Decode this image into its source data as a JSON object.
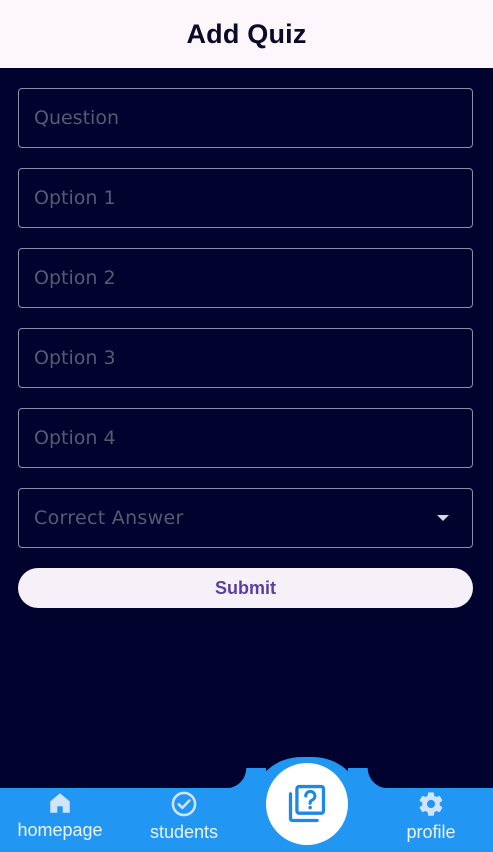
{
  "appbar": {
    "title": "Add Quiz"
  },
  "form": {
    "question_placeholder": "Question",
    "option1_placeholder": "Option 1",
    "option2_placeholder": "Option 2",
    "option3_placeholder": "Option 3",
    "option4_placeholder": "Option 4",
    "correct_answer_placeholder": "Correct Answer",
    "submit_label": "Submit"
  },
  "nav": {
    "items": [
      {
        "label": "homepage",
        "icon": "home-icon"
      },
      {
        "label": "students",
        "icon": "check-circle-icon"
      },
      {
        "label": "",
        "icon": "quiz-library-icon"
      },
      {
        "label": "profile",
        "icon": "gear-icon"
      }
    ]
  },
  "colors": {
    "background": "#02022f",
    "appbar": "#fdf6fb",
    "nav": "#2196f3",
    "submit_bg": "#f6f1f8",
    "submit_text": "#5a3fa0"
  }
}
